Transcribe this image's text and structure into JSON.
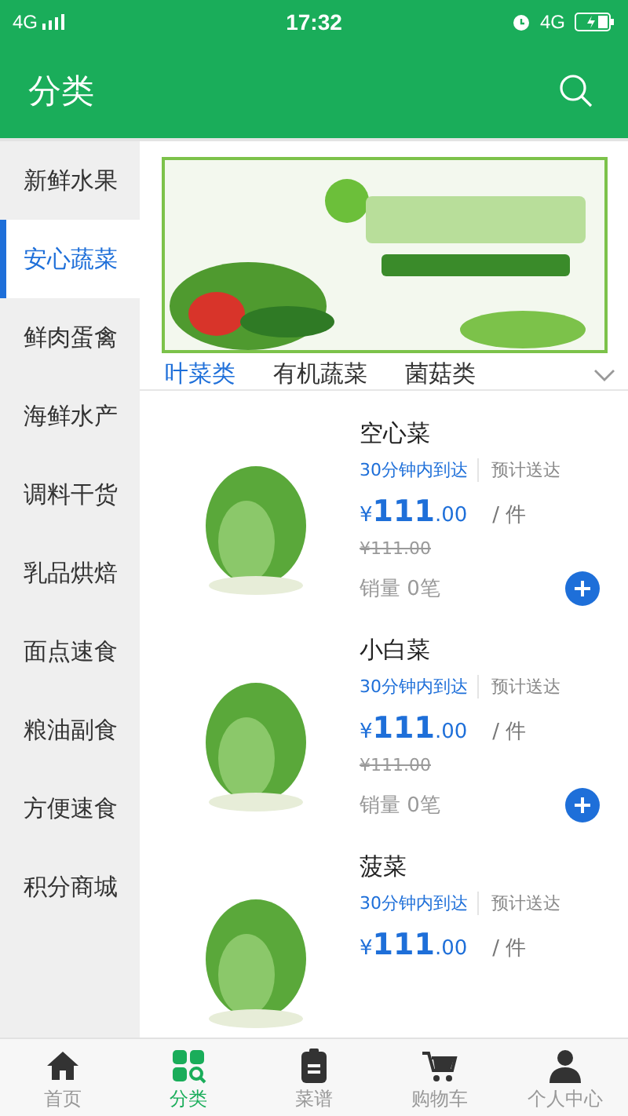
{
  "status_bar": {
    "network": "4G",
    "time": "17:32",
    "network_right": "4G"
  },
  "header": {
    "title": "分类"
  },
  "sidebar": {
    "items": [
      {
        "label": "新鲜水果",
        "selected": false
      },
      {
        "label": "安心蔬菜",
        "selected": true
      },
      {
        "label": "鲜肉蛋禽",
        "selected": false
      },
      {
        "label": "海鲜水产",
        "selected": false
      },
      {
        "label": "调料干货",
        "selected": false
      },
      {
        "label": "乳品烘焙",
        "selected": false
      },
      {
        "label": "面点速食",
        "selected": false
      },
      {
        "label": "粮油副食",
        "selected": false
      },
      {
        "label": "方便速食",
        "selected": false
      },
      {
        "label": "积分商城",
        "selected": false
      }
    ]
  },
  "subtabs": [
    {
      "label": "叶菜类",
      "selected": true
    },
    {
      "label": "有机蔬菜",
      "selected": false
    },
    {
      "label": "菌菇类",
      "selected": false
    }
  ],
  "products": [
    {
      "name": "空心菜",
      "delivery": "30分钟内到达",
      "eta": "预计送达",
      "currency": "¥",
      "price": "111",
      "decimals": ".00",
      "unit": "/ 件",
      "original_price": "¥111.00",
      "sales": "销量 0笔"
    },
    {
      "name": "小白菜",
      "delivery": "30分钟内到达",
      "eta": "预计送达",
      "currency": "¥",
      "price": "111",
      "decimals": ".00",
      "unit": "/ 件",
      "original_price": "¥111.00",
      "sales": "销量 0笔"
    },
    {
      "name": "菠菜",
      "delivery": "30分钟内到达",
      "eta": "预计送达",
      "currency": "¥",
      "price": "111",
      "decimals": ".00",
      "unit": "/ 件"
    }
  ],
  "bottom_nav": [
    {
      "kind": "home",
      "label": "首页",
      "selected": false
    },
    {
      "kind": "category",
      "label": "分类",
      "selected": true
    },
    {
      "kind": "recipe",
      "label": "菜谱",
      "selected": false
    },
    {
      "kind": "cart",
      "label": "购物车",
      "selected": false
    },
    {
      "kind": "user",
      "label": "个人中心",
      "selected": false
    }
  ]
}
